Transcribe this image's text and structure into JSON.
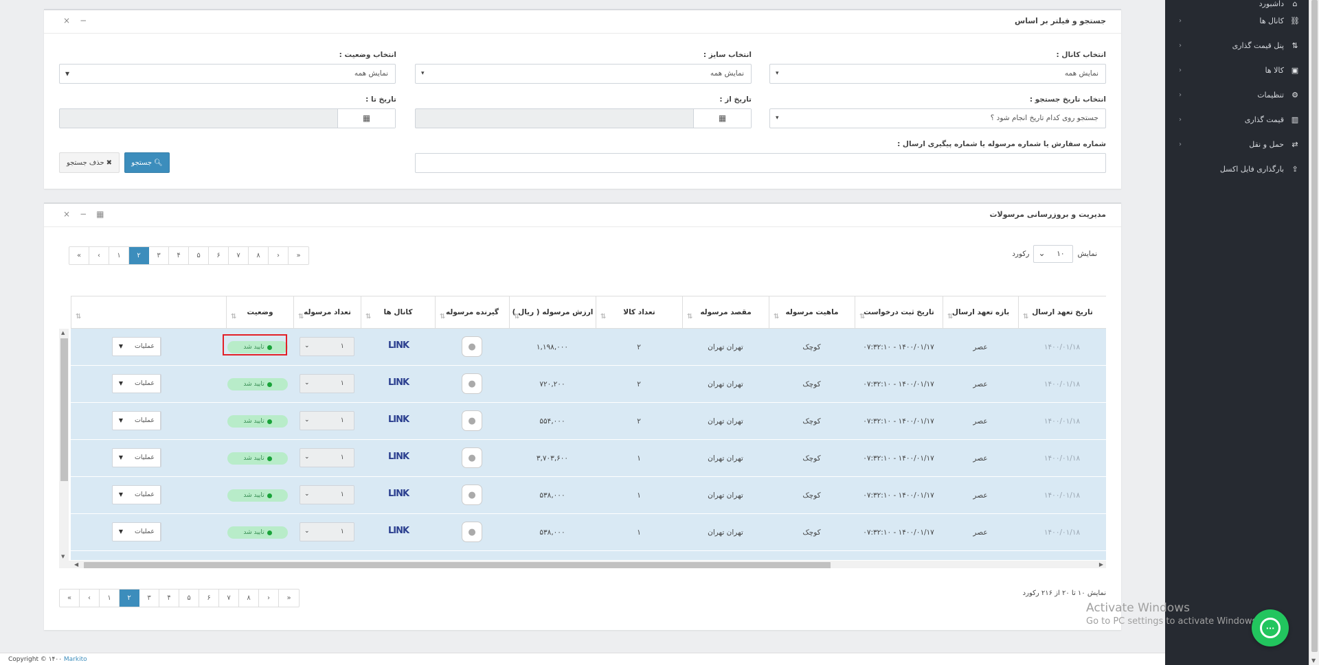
{
  "sidebar": {
    "items": [
      {
        "label": "داشبورد",
        "icon": "dashboard-icon",
        "glyph": "⌂",
        "has_children": false
      },
      {
        "label": "کانال ها",
        "icon": "link-icon",
        "glyph": "⛓",
        "has_children": true
      },
      {
        "label": "پنل قیمت گذاری",
        "icon": "sort-icon",
        "glyph": "⇅",
        "has_children": true
      },
      {
        "label": "کالا ها",
        "icon": "cubes-icon",
        "glyph": "▣",
        "has_children": true
      },
      {
        "label": "تنظیمات",
        "icon": "gear-icon",
        "glyph": "⚙",
        "has_children": true
      },
      {
        "label": "قیمت گذاری",
        "icon": "chart-icon",
        "glyph": "▥",
        "has_children": true
      },
      {
        "label": "حمل و نقل",
        "icon": "exchange-icon",
        "glyph": "⇄",
        "has_children": true
      },
      {
        "label": "بارگذاری فایل اکسل",
        "icon": "upload-icon",
        "glyph": "⇪",
        "has_children": false
      }
    ],
    "chevron": "‹"
  },
  "filter_panel": {
    "title": "جستجو و فیلتر بر اساس",
    "close": "×",
    "minimize": "−",
    "channel": {
      "label": "انتخاب کانال :",
      "value": "نمایش همه"
    },
    "size": {
      "label": "انتخاب سایز :",
      "value": "نمایش همه"
    },
    "status": {
      "label": "انتخاب وضعیت :",
      "value": "نمایش همه"
    },
    "date_type": {
      "label": "انتخاب تاریخ جستجو :",
      "value": "جستجو روی کدام تاریخ انجام شود ؟"
    },
    "date_from": {
      "label": "تاریخ از :"
    },
    "date_to": {
      "label": "تاریخ تا :"
    },
    "order_search": {
      "label": "شماره سفارش یا شماره مرسوله یا شماره پیگیری ارسال :",
      "value": ""
    },
    "search_button": "جستجو",
    "clear_button": "حذف جستجو",
    "caret": "▾",
    "calendar_glyph": "▦"
  },
  "shipments_panel": {
    "title": "مدیریت و بروزرسانی مرسولات",
    "close": "×",
    "minimize": "−",
    "table_icon": "▦",
    "page_size": {
      "prefix": "نمایش",
      "value": "۱۰",
      "suffix": "رکورد"
    },
    "pagination": [
      "«",
      "‹",
      "۱",
      "۲",
      "۳",
      "۴",
      "۵",
      "۶",
      "۷",
      "۸",
      "›",
      "»"
    ],
    "active_page": "۲",
    "summary": "نمایش ۱۰ تا ۲۰ از ۲۱۶ رکورد",
    "columns": [
      "تاریخ تعهد ارسال",
      "بازه تعهد ارسال",
      "تاریخ ثبت درخواست",
      "ماهیت مرسوله",
      "مقصد مرسوله",
      "تعداد کالا",
      "ارزش مرسوله ( ریال )",
      "گیرنده مرسوله",
      "کانال ها",
      "تعداد مرسوله",
      "وضعیت",
      ""
    ],
    "sort_glyph": "⇅",
    "rows": [
      {
        "commit_date": "۱۴۰۰/۰۱/۱۸",
        "window": "عصر",
        "created": "۱۴۰۰/۰۱/۱۷ - ۰۷:۳۲:۱۰",
        "type": "کوچک",
        "destination": "تهران تهران",
        "items": "۲",
        "value": "۱,۱۹۸,۰۰۰",
        "channel": "LINK",
        "qty": "۱",
        "status": "تایید شد",
        "ops": "عملیات"
      },
      {
        "commit_date": "۱۴۰۰/۰۱/۱۸",
        "window": "عصر",
        "created": "۱۴۰۰/۰۱/۱۷ - ۰۷:۳۲:۱۰",
        "type": "کوچک",
        "destination": "تهران تهران",
        "items": "۲",
        "value": "۷۲۰,۲۰۰",
        "channel": "LINK",
        "qty": "۱",
        "status": "تایید شد",
        "ops": "عملیات"
      },
      {
        "commit_date": "۱۴۰۰/۰۱/۱۸",
        "window": "عصر",
        "created": "۱۴۰۰/۰۱/۱۷ - ۰۷:۳۲:۱۰",
        "type": "کوچک",
        "destination": "تهران تهران",
        "items": "۲",
        "value": "۵۵۴,۰۰۰",
        "channel": "LINK",
        "qty": "۱",
        "status": "تایید شد",
        "ops": "عملیات"
      },
      {
        "commit_date": "۱۴۰۰/۰۱/۱۸",
        "window": "عصر",
        "created": "۱۴۰۰/۰۱/۱۷ - ۰۷:۳۲:۱۰",
        "type": "کوچک",
        "destination": "تهران تهران",
        "items": "۱",
        "value": "۳,۷۰۳,۶۰۰",
        "channel": "LINK",
        "qty": "۱",
        "status": "تایید شد",
        "ops": "عملیات"
      },
      {
        "commit_date": "۱۴۰۰/۰۱/۱۸",
        "window": "عصر",
        "created": "۱۴۰۰/۰۱/۱۷ - ۰۷:۳۲:۱۰",
        "type": "کوچک",
        "destination": "تهران تهران",
        "items": "۱",
        "value": "۵۳۸,۰۰۰",
        "channel": "LINK",
        "qty": "۱",
        "status": "تایید شد",
        "ops": "عملیات"
      },
      {
        "commit_date": "۱۴۰۰/۰۱/۱۸",
        "window": "عصر",
        "created": "۱۴۰۰/۰۱/۱۷ - ۰۷:۳۲:۱۰",
        "type": "کوچک",
        "destination": "تهران تهران",
        "items": "۱",
        "value": "۵۳۸,۰۰۰",
        "channel": "LINK",
        "qty": "۱",
        "status": "تایید شد",
        "ops": "عملیات"
      }
    ]
  },
  "watermark": {
    "line1": "Activate Windows",
    "line2": "Go to PC settings to activate Windows."
  },
  "footer": {
    "text": "Copyright © ۱۴۰۰ ",
    "brand": "Markito"
  },
  "colors": {
    "sidebar_bg": "#262a31",
    "primary": "#3c8dbc",
    "row_bg": "#d9e9f4",
    "status_green": "#1aa33a",
    "highlight_red": "#e21f26",
    "chat_green": "#22c55e"
  }
}
